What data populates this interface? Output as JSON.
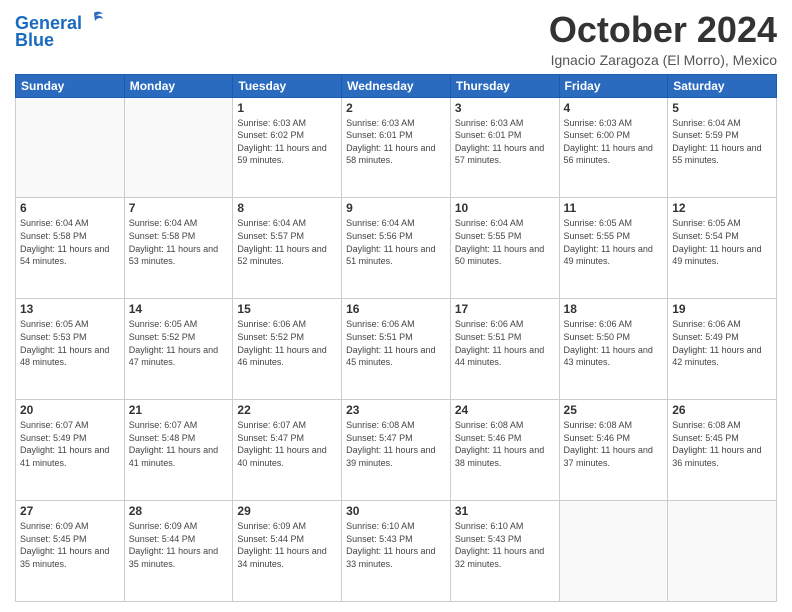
{
  "header": {
    "logo_line1": "General",
    "logo_line2": "Blue",
    "month_title": "October 2024",
    "location": "Ignacio Zaragoza (El Morro), Mexico"
  },
  "days_of_week": [
    "Sunday",
    "Monday",
    "Tuesday",
    "Wednesday",
    "Thursday",
    "Friday",
    "Saturday"
  ],
  "weeks": [
    [
      {
        "day": "",
        "info": ""
      },
      {
        "day": "",
        "info": ""
      },
      {
        "day": "1",
        "info": "Sunrise: 6:03 AM\nSunset: 6:02 PM\nDaylight: 11 hours and 59 minutes."
      },
      {
        "day": "2",
        "info": "Sunrise: 6:03 AM\nSunset: 6:01 PM\nDaylight: 11 hours and 58 minutes."
      },
      {
        "day": "3",
        "info": "Sunrise: 6:03 AM\nSunset: 6:01 PM\nDaylight: 11 hours and 57 minutes."
      },
      {
        "day": "4",
        "info": "Sunrise: 6:03 AM\nSunset: 6:00 PM\nDaylight: 11 hours and 56 minutes."
      },
      {
        "day": "5",
        "info": "Sunrise: 6:04 AM\nSunset: 5:59 PM\nDaylight: 11 hours and 55 minutes."
      }
    ],
    [
      {
        "day": "6",
        "info": "Sunrise: 6:04 AM\nSunset: 5:58 PM\nDaylight: 11 hours and 54 minutes."
      },
      {
        "day": "7",
        "info": "Sunrise: 6:04 AM\nSunset: 5:58 PM\nDaylight: 11 hours and 53 minutes."
      },
      {
        "day": "8",
        "info": "Sunrise: 6:04 AM\nSunset: 5:57 PM\nDaylight: 11 hours and 52 minutes."
      },
      {
        "day": "9",
        "info": "Sunrise: 6:04 AM\nSunset: 5:56 PM\nDaylight: 11 hours and 51 minutes."
      },
      {
        "day": "10",
        "info": "Sunrise: 6:04 AM\nSunset: 5:55 PM\nDaylight: 11 hours and 50 minutes."
      },
      {
        "day": "11",
        "info": "Sunrise: 6:05 AM\nSunset: 5:55 PM\nDaylight: 11 hours and 49 minutes."
      },
      {
        "day": "12",
        "info": "Sunrise: 6:05 AM\nSunset: 5:54 PM\nDaylight: 11 hours and 49 minutes."
      }
    ],
    [
      {
        "day": "13",
        "info": "Sunrise: 6:05 AM\nSunset: 5:53 PM\nDaylight: 11 hours and 48 minutes."
      },
      {
        "day": "14",
        "info": "Sunrise: 6:05 AM\nSunset: 5:52 PM\nDaylight: 11 hours and 47 minutes."
      },
      {
        "day": "15",
        "info": "Sunrise: 6:06 AM\nSunset: 5:52 PM\nDaylight: 11 hours and 46 minutes."
      },
      {
        "day": "16",
        "info": "Sunrise: 6:06 AM\nSunset: 5:51 PM\nDaylight: 11 hours and 45 minutes."
      },
      {
        "day": "17",
        "info": "Sunrise: 6:06 AM\nSunset: 5:51 PM\nDaylight: 11 hours and 44 minutes."
      },
      {
        "day": "18",
        "info": "Sunrise: 6:06 AM\nSunset: 5:50 PM\nDaylight: 11 hours and 43 minutes."
      },
      {
        "day": "19",
        "info": "Sunrise: 6:06 AM\nSunset: 5:49 PM\nDaylight: 11 hours and 42 minutes."
      }
    ],
    [
      {
        "day": "20",
        "info": "Sunrise: 6:07 AM\nSunset: 5:49 PM\nDaylight: 11 hours and 41 minutes."
      },
      {
        "day": "21",
        "info": "Sunrise: 6:07 AM\nSunset: 5:48 PM\nDaylight: 11 hours and 41 minutes."
      },
      {
        "day": "22",
        "info": "Sunrise: 6:07 AM\nSunset: 5:47 PM\nDaylight: 11 hours and 40 minutes."
      },
      {
        "day": "23",
        "info": "Sunrise: 6:08 AM\nSunset: 5:47 PM\nDaylight: 11 hours and 39 minutes."
      },
      {
        "day": "24",
        "info": "Sunrise: 6:08 AM\nSunset: 5:46 PM\nDaylight: 11 hours and 38 minutes."
      },
      {
        "day": "25",
        "info": "Sunrise: 6:08 AM\nSunset: 5:46 PM\nDaylight: 11 hours and 37 minutes."
      },
      {
        "day": "26",
        "info": "Sunrise: 6:08 AM\nSunset: 5:45 PM\nDaylight: 11 hours and 36 minutes."
      }
    ],
    [
      {
        "day": "27",
        "info": "Sunrise: 6:09 AM\nSunset: 5:45 PM\nDaylight: 11 hours and 35 minutes."
      },
      {
        "day": "28",
        "info": "Sunrise: 6:09 AM\nSunset: 5:44 PM\nDaylight: 11 hours and 35 minutes."
      },
      {
        "day": "29",
        "info": "Sunrise: 6:09 AM\nSunset: 5:44 PM\nDaylight: 11 hours and 34 minutes."
      },
      {
        "day": "30",
        "info": "Sunrise: 6:10 AM\nSunset: 5:43 PM\nDaylight: 11 hours and 33 minutes."
      },
      {
        "day": "31",
        "info": "Sunrise: 6:10 AM\nSunset: 5:43 PM\nDaylight: 11 hours and 32 minutes."
      },
      {
        "day": "",
        "info": ""
      },
      {
        "day": "",
        "info": ""
      }
    ]
  ]
}
